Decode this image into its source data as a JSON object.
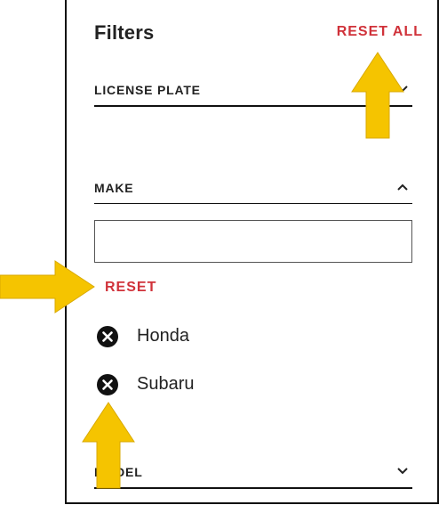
{
  "header": {
    "title": "Filters",
    "reset_all_label": "RESET ALL"
  },
  "sections": {
    "license_plate": {
      "label": "LICENSE PLATE",
      "chevron": "chevron-down-icon"
    },
    "make": {
      "label": "MAKE",
      "chevron": "chevron-up-icon",
      "input_value": "",
      "reset_label": "RESET",
      "selected": [
        {
          "label": "Honda",
          "icon": "remove-circle-icon"
        },
        {
          "label": "Subaru",
          "icon": "remove-circle-icon"
        }
      ]
    },
    "model": {
      "label": "MODEL",
      "chevron": "chevron-down-icon"
    }
  },
  "colors": {
    "accent_red": "#d0323a",
    "annotation_arrow": "#f5c400",
    "text": "#222222"
  }
}
